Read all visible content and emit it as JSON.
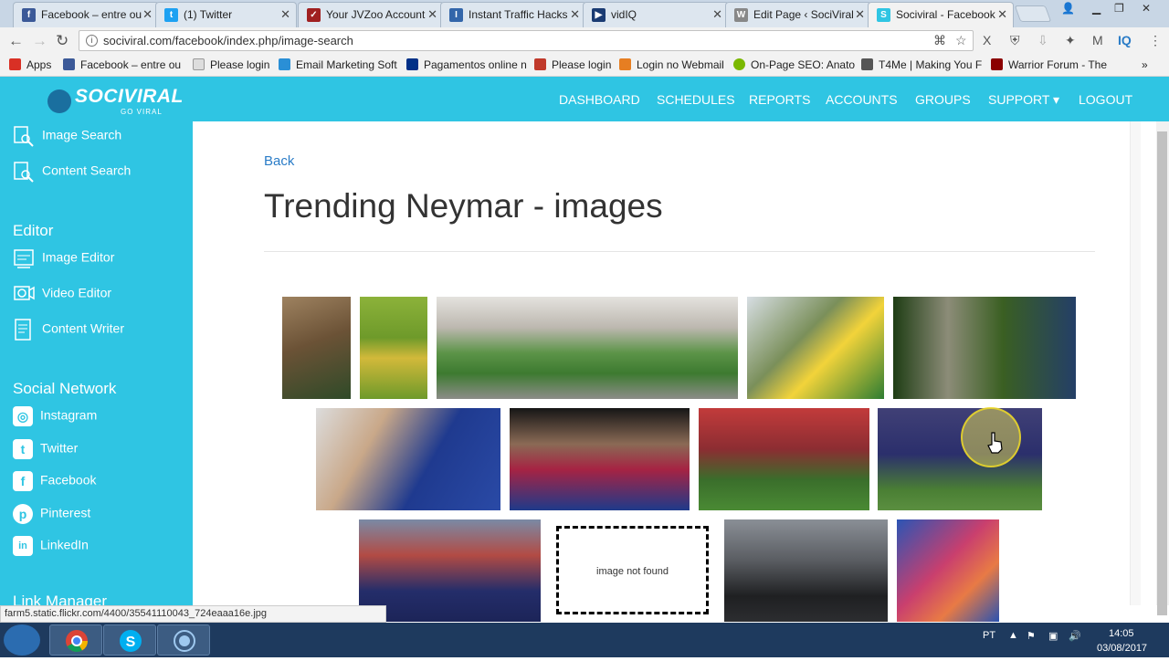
{
  "tabs": [
    {
      "title": "Facebook – entre ou",
      "color": "#3b5998",
      "glyph": "f",
      "active": false
    },
    {
      "title": "(1) Twitter",
      "color": "#1da1f2",
      "glyph": "t",
      "active": false
    },
    {
      "title": "Your JVZoo Account",
      "color": "#a02020",
      "glyph": "✓",
      "active": false
    },
    {
      "title": "Instant Traffic Hacks",
      "color": "#3366aa",
      "glyph": "I",
      "active": false
    },
    {
      "title": "vidIQ",
      "color": "#1a3b73",
      "glyph": "▶",
      "active": false
    },
    {
      "title": "Edit Page ‹ SociViral",
      "color": "#888888",
      "glyph": "W",
      "active": false
    },
    {
      "title": "Sociviral - Facebook",
      "color": "#2fc5e3",
      "glyph": "S",
      "active": true
    }
  ],
  "address": "sociviral.com/facebook/index.php/image-search",
  "bookmarks": [
    {
      "label": "Apps",
      "color": "#d93025"
    },
    {
      "label": "Facebook – entre ou",
      "color": "#3b5998"
    },
    {
      "label": "Please login",
      "color": "#dddddd"
    },
    {
      "label": "Email Marketing Soft",
      "color": "#2a8fd6"
    },
    {
      "label": "Pagamentos online n",
      "color": "#003087"
    },
    {
      "label": "Please login",
      "color": "#c0392b"
    },
    {
      "label": "Login no Webmail",
      "color": "#e67e22"
    },
    {
      "label": "On-Page SEO: Anato",
      "color": "#7ab800"
    },
    {
      "label": "T4Me | Making You F",
      "color": "#555555"
    },
    {
      "label": "Warrior Forum - The",
      "color": "#8b0000"
    }
  ],
  "site": {
    "logo_word": "SOCIVIRAL",
    "logo_tag": "GO VIRAL",
    "nav": [
      "DASHBOARD",
      "SCHEDULES",
      "REPORTS",
      "ACCOUNTS",
      "GROUPS",
      "SUPPORT ▾",
      "LOGOUT"
    ]
  },
  "sidebar": {
    "search_items": [
      {
        "label": "Image Search",
        "icon": "image-search-icon"
      },
      {
        "label": "Content Search",
        "icon": "content-search-icon"
      }
    ],
    "editor_heading": "Editor",
    "editor_items": [
      {
        "label": "Image Editor",
        "icon": "image-editor-icon"
      },
      {
        "label": "Video Editor",
        "icon": "video-editor-icon"
      },
      {
        "label": "Content Writer",
        "icon": "content-writer-icon"
      }
    ],
    "social_heading": "Social Network",
    "social_items": [
      {
        "label": "Instagram",
        "icon": "instagram-icon",
        "glyph": "◎"
      },
      {
        "label": "Twitter",
        "icon": "twitter-icon",
        "glyph": "t"
      },
      {
        "label": "Facebook",
        "icon": "facebook-icon",
        "glyph": "f"
      },
      {
        "label": "Pinterest",
        "icon": "pinterest-icon",
        "glyph": "p"
      },
      {
        "label": "LinkedIn",
        "icon": "linkedin-icon",
        "glyph": "in"
      }
    ],
    "link_heading": "Link Manager"
  },
  "main": {
    "back_label": "Back",
    "title": "Trending Neymar - images",
    "not_found_text": "image not found"
  },
  "images": [
    {
      "name": "image-child-parent",
      "colors": [
        "#7a5a3a",
        "#3b4f2e"
      ]
    },
    {
      "name": "image-child-grass",
      "colors": [
        "#7fa833",
        "#d9c23a"
      ]
    },
    {
      "name": "image-stadium",
      "colors": [
        "#d9d6d2",
        "#4c8a3c"
      ]
    },
    {
      "name": "image-fans-celebration",
      "colors": [
        "#cfd8de",
        "#2e7d32"
      ]
    },
    {
      "name": "image-trophy-neymar",
      "colors": [
        "#1e3d14",
        "#3a6c22"
      ]
    },
    {
      "name": "image-hazard-ball",
      "colors": [
        "#203a8f",
        "#c6a88a"
      ]
    },
    {
      "name": "image-neymar-barca-shirt",
      "colors": [
        "#1e1e1e",
        "#a32040"
      ]
    },
    {
      "name": "image-neymar-pitch-1",
      "colors": [
        "#c54040",
        "#3c6e2c"
      ]
    },
    {
      "name": "image-neymar-pitch-2",
      "colors": [
        "#3b3b7a",
        "#4a7f34"
      ]
    },
    {
      "name": "image-neymar-qatar",
      "colors": [
        "#27306e",
        "#b0423f"
      ]
    },
    {
      "name": "image-mourinho",
      "colors": [
        "#7a7f86",
        "#1f2022"
      ]
    },
    {
      "name": "image-neymar-psg",
      "colors": [
        "#c94070",
        "#2a53b0"
      ]
    }
  ],
  "status_url": "farm5.static.flickr.com/4400/35541110043_724eaaa16e.jpg",
  "taskbar": {
    "lang": "PT",
    "time": "14:05",
    "date": "03/08/2017"
  }
}
